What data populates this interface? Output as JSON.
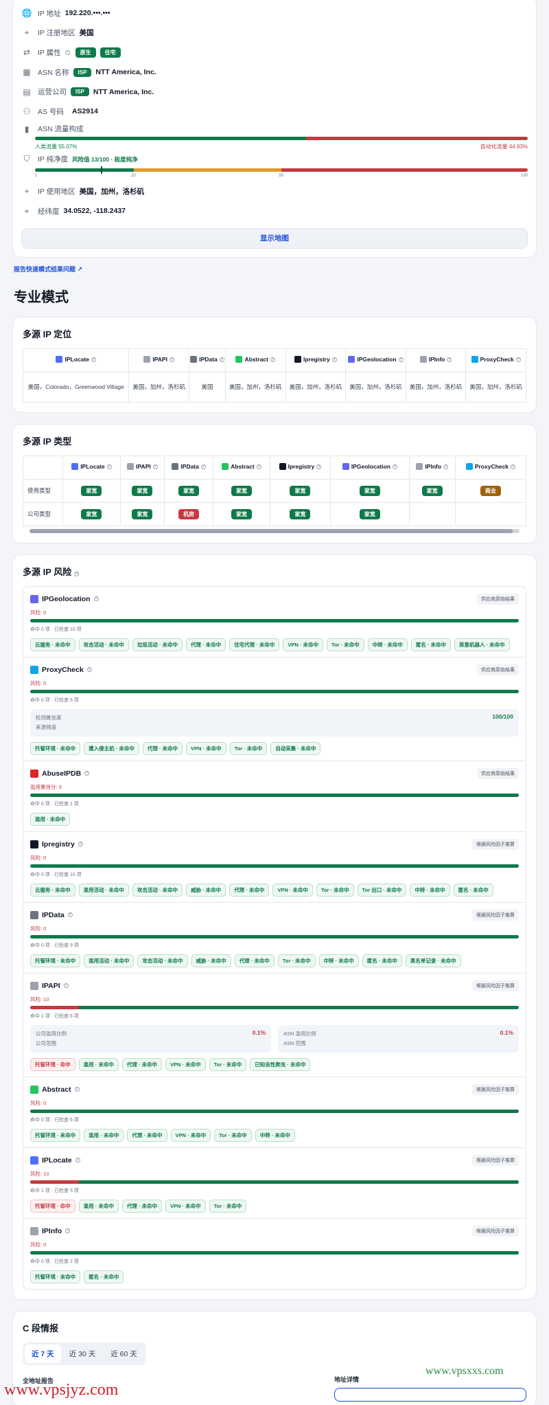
{
  "info": {
    "ip_label": "IP 地址",
    "ip_value": "192.220.•••.•••",
    "reg_label": "IP 注册地区",
    "reg_value": "美国",
    "attr_label": "IP 属性",
    "attr_tags": [
      "原生",
      "住宅"
    ],
    "asn_name_label": "ASN 名称",
    "asn_name_tag": "ISP",
    "asn_name_value": "NTT America, Inc.",
    "operator_label": "运营公司",
    "operator_tag": "ISP",
    "operator_value": "NTT America, Inc.",
    "as_label": "AS 号码",
    "as_value": "AS2914",
    "traffic_label": "ASN 流量构成",
    "human_label": "人类流量 55.07%",
    "bot_label": "自动化流量 44.93%",
    "human_pct": 55.07,
    "purity_label": "IP 纯净度",
    "purity_value": "风险值 13/100 · 极度纯净",
    "purity_score": 13,
    "purity_ticks": [
      "1",
      "20",
      "50",
      "100"
    ],
    "usage_label": "IP 使用地区",
    "usage_value": "美国，加州，洛杉矶",
    "coord_label": "经纬度",
    "coord_value": "34.0522, -118.2437",
    "map_button": "显示地图"
  },
  "report_link": "报告快速模式结果问题",
  "pro_title": "专业模式",
  "geo": {
    "title": "多源 IP 定位",
    "providers": [
      "IPLocate",
      "IPAPI",
      "IPData",
      "Abstract",
      "Ipregistry",
      "IPGeolocation",
      "IPInfo",
      "ProxyCheck"
    ],
    "values": [
      "美国，Colorado，Greenwood Village",
      "美国，加州，洛杉矶",
      "美国",
      "美国，加州，洛杉矶",
      "美国，加州，洛杉矶",
      "美国，加州，洛杉矶",
      "美国，加州，洛杉矶",
      "美国，加州，洛杉矶"
    ]
  },
  "type": {
    "title": "多源 IP 类型",
    "providers": [
      "IPLocate",
      "IPAPI",
      "IPData",
      "Abstract",
      "Ipregistry",
      "IPGeolocation",
      "IPInfo",
      "ProxyCheck"
    ],
    "rows": [
      {
        "label": "使用类型",
        "values": [
          "家宽",
          "家宽",
          "家宽",
          "家宽",
          "家宽",
          "家宽",
          "家宽",
          "商业"
        ]
      },
      {
        "label": "公司类型",
        "values": [
          "家宽",
          "家宽",
          "机房",
          "家宽",
          "家宽",
          "家宽",
          "",
          ""
        ]
      }
    ]
  },
  "risk": {
    "title": "多源 IP 风险",
    "items": [
      {
        "name": "IPGeolocation",
        "badge": "供应商原始结果",
        "score": "风险: 0",
        "pct": 0,
        "sub": "命中 0 项 · 已检查 10 项",
        "tags": [
          [
            "云服务 · 未命中",
            0
          ],
          [
            "攻击活动 · 未命中",
            0
          ],
          [
            "垃圾活动 · 未命中",
            0
          ],
          [
            "代理 · 未命中",
            0
          ],
          [
            "住宅代理 · 未命中",
            0
          ],
          [
            "VPN · 未命中",
            0
          ],
          [
            "Tor · 未命中",
            0
          ],
          [
            "中转 · 未命中",
            0
          ],
          [
            "匿名 · 未命中",
            0
          ],
          [
            "恶意机器人 · 未命中",
            0
          ]
        ]
      },
      {
        "name": "ProxyCheck",
        "badge": "供应商原始结果",
        "score": "风险: 0",
        "pct": 0,
        "sub": "命中 0 项 · 已检查 6 项",
        "detect": {
          "label": "检测置信度",
          "source": "来源频道",
          "value": "100/100"
        },
        "tags": [
          [
            "托管环境 · 未命中",
            0
          ],
          [
            "遭入侵主机 · 未命中",
            0
          ],
          [
            "代理 · 未命中",
            0
          ],
          [
            "VPN · 未命中",
            0
          ],
          [
            "Tor · 未命中",
            0
          ],
          [
            "自动采集 · 未命中",
            0
          ]
        ]
      },
      {
        "name": "AbuseIPDB",
        "badge": "供应商原始结果",
        "score": "滥用置信分: 0",
        "pct": 0,
        "sub": "命中 0 项 · 已检查 1 项",
        "tags": [
          [
            "滥用 · 未命中",
            0
          ]
        ]
      },
      {
        "name": "Ipregistry",
        "badge": "根据风险因子推算",
        "score": "风险: 0",
        "pct": 0,
        "sub": "命中 0 项 · 已检查 10 项",
        "tags": [
          [
            "云服务 · 未命中",
            0
          ],
          [
            "滥用活动 · 未命中",
            0
          ],
          [
            "攻击活动 · 未命中",
            0
          ],
          [
            "威胁 · 未命中",
            0
          ],
          [
            "代理 · 未命中",
            0
          ],
          [
            "VPN · 未命中",
            0
          ],
          [
            "Tor · 未命中",
            0
          ],
          [
            "Tor 出口 · 未命中",
            0
          ],
          [
            "中转 · 未命中",
            0
          ],
          [
            "匿名 · 未命中",
            0
          ]
        ]
      },
      {
        "name": "IPData",
        "badge": "根据风险因子推算",
        "score": "风险: 0",
        "pct": 0,
        "sub": "命中 0 项 · 已检查 9 项",
        "tags": [
          [
            "托管环境 · 未命中",
            0
          ],
          [
            "滥用活动 · 未命中",
            0
          ],
          [
            "攻击活动 · 未命中",
            0
          ],
          [
            "威胁 · 未命中",
            0
          ],
          [
            "代理 · 未命中",
            0
          ],
          [
            "Tor · 未命中",
            0
          ],
          [
            "中转 · 未命中",
            0
          ],
          [
            "匿名 · 未命中",
            0
          ],
          [
            "黑名单记录 · 未命中",
            0
          ]
        ]
      },
      {
        "name": "IPAPI",
        "badge": "根据风险因子推算",
        "score": "风险: 10",
        "pct": 10,
        "sub": "命中 1 项 · 已检查 6 项",
        "ratios": [
          {
            "label": "公司滥用比例",
            "sub": "公司范围",
            "value": "0.1%"
          },
          {
            "label": "ASN 滥用比例",
            "sub": "ASN 范围",
            "value": "0.1%"
          }
        ],
        "tags": [
          [
            "托管环境 · 命中",
            1
          ],
          [
            "滥用 · 未命中",
            0
          ],
          [
            "代理 · 未命中",
            0
          ],
          [
            "VPN · 未命中",
            0
          ],
          [
            "Tor · 未命中",
            0
          ],
          [
            "已知良性爬虫 · 未命中",
            0
          ]
        ]
      },
      {
        "name": "Abstract",
        "badge": "根据风险因子推算",
        "score": "风险: 0",
        "pct": 0,
        "sub": "命中 0 项 · 已检查 6 项",
        "tags": [
          [
            "托管环境 · 未命中",
            0
          ],
          [
            "滥用 · 未命中",
            0
          ],
          [
            "代理 · 未命中",
            0
          ],
          [
            "VPN · 未命中",
            0
          ],
          [
            "Tor · 未命中",
            0
          ],
          [
            "中转 · 未命中",
            0
          ]
        ]
      },
      {
        "name": "IPLocate",
        "badge": "根据风险因子推算",
        "score": "风险: 10",
        "pct": 10,
        "sub": "命中 1 项 · 已检查 5 项",
        "tags": [
          [
            "托管环境 · 命中",
            1
          ],
          [
            "滥用 · 未命中",
            0
          ],
          [
            "代理 · 未命中",
            0
          ],
          [
            "VPN · 未命中",
            0
          ],
          [
            "Tor · 未命中",
            0
          ]
        ]
      },
      {
        "name": "IPInfo",
        "badge": "根据风险因子推算",
        "score": "风险: 0",
        "pct": 0,
        "sub": "命中 0 项 · 已检查 2 项",
        "tags": [
          [
            "托管环境 · 未命中",
            0
          ],
          [
            "匿名 · 未命中",
            0
          ]
        ]
      }
    ]
  },
  "csegment": {
    "title": "C 段情报",
    "tabs": [
      "近 7 天",
      "近 30 天",
      "近 60 天"
    ],
    "left_heading": "全地址报告",
    "right_heading": "地址详情"
  },
  "watermarks": {
    "green": "www.vpsxxs.com",
    "red": "www.vpsjyz.com"
  },
  "colors": {
    "green": "#0f7a4a",
    "red": "#c53940",
    "orange": "#e09b2d",
    "blue": "#1d4ed8"
  }
}
